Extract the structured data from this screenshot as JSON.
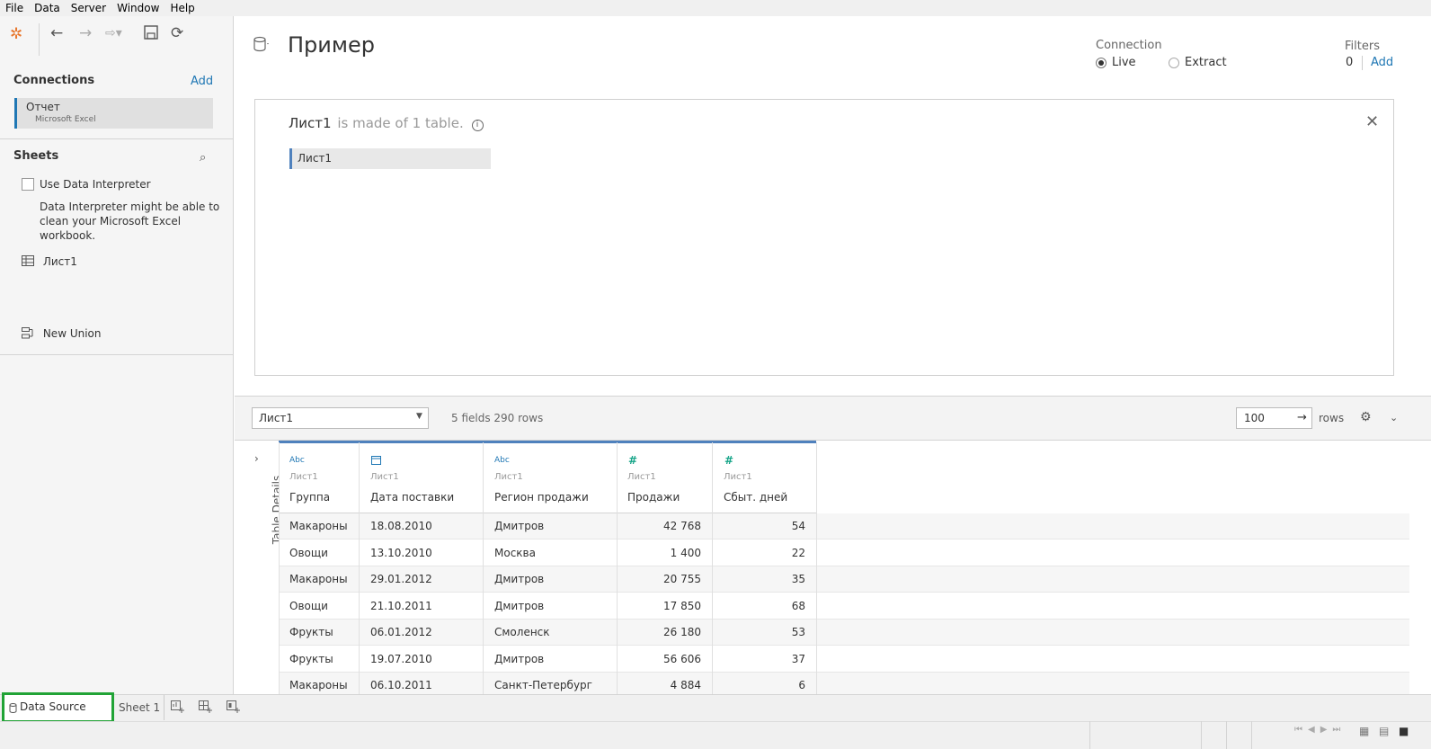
{
  "menu": [
    "File",
    "Data",
    "Server",
    "Window",
    "Help"
  ],
  "left": {
    "connections_title": "Connections",
    "connections_add": "Add",
    "connection_name": "Отчет",
    "connection_type": "Microsoft Excel",
    "sheets_title": "Sheets",
    "use_interpreter": "Use Data Interpreter",
    "interpreter_hint": [
      "Data Interpreter might be able to",
      "clean your Microsoft Excel",
      "workbook."
    ],
    "sheet_item": "Лист1",
    "new_union": "New Union"
  },
  "header": {
    "datasource_title": "Пример",
    "connection_label": "Connection",
    "live_label": "Live",
    "extract_label": "Extract",
    "connection_mode": "Live",
    "filters_label": "Filters",
    "filters_count": "0",
    "filters_add": "Add"
  },
  "canvas": {
    "sheet_name": "Лист1",
    "made_of": "is made of 1 table.",
    "table_chip": "Лист1"
  },
  "grid_toolbar": {
    "table_select": "Лист1",
    "fields_rows": "5 fields 290 rows",
    "rows_value": "100",
    "rows_label": "rows"
  },
  "table_details_label": "Table Details",
  "grid": {
    "columns": [
      {
        "type": "Abc",
        "source": "Лист1",
        "name": "Группа"
      },
      {
        "type": "date",
        "source": "Лист1",
        "name": "Дата поставки"
      },
      {
        "type": "Abc",
        "source": "Лист1",
        "name": "Регион продажи"
      },
      {
        "type": "#",
        "source": "Лист1",
        "name": "Продажи"
      },
      {
        "type": "#",
        "source": "Лист1",
        "name": "Сбыт. дней"
      }
    ],
    "rows": [
      [
        "Макароны",
        "18.08.2010",
        "Дмитров",
        "42 768",
        "54"
      ],
      [
        "Овощи",
        "13.10.2010",
        "Москва",
        "1 400",
        "22"
      ],
      [
        "Макароны",
        "29.01.2012",
        "Дмитров",
        "20 755",
        "35"
      ],
      [
        "Овощи",
        "21.10.2011",
        "Дмитров",
        "17 850",
        "68"
      ],
      [
        "Фрукты",
        "06.01.2012",
        "Смоленск",
        "26 180",
        "53"
      ],
      [
        "Фрукты",
        "19.07.2010",
        "Дмитров",
        "56 606",
        "37"
      ],
      [
        "Макароны",
        "06.10.2011",
        "Санкт-Петербург",
        "4 884",
        "6"
      ]
    ]
  },
  "tabs": {
    "data_source": "Data Source",
    "sheet1": "Sheet 1"
  },
  "colors": {
    "accent_blue": "#1f77b4",
    "header_bar": "#4f81bd",
    "measure_green": "#17a589",
    "highlight_green": "#21a336"
  }
}
